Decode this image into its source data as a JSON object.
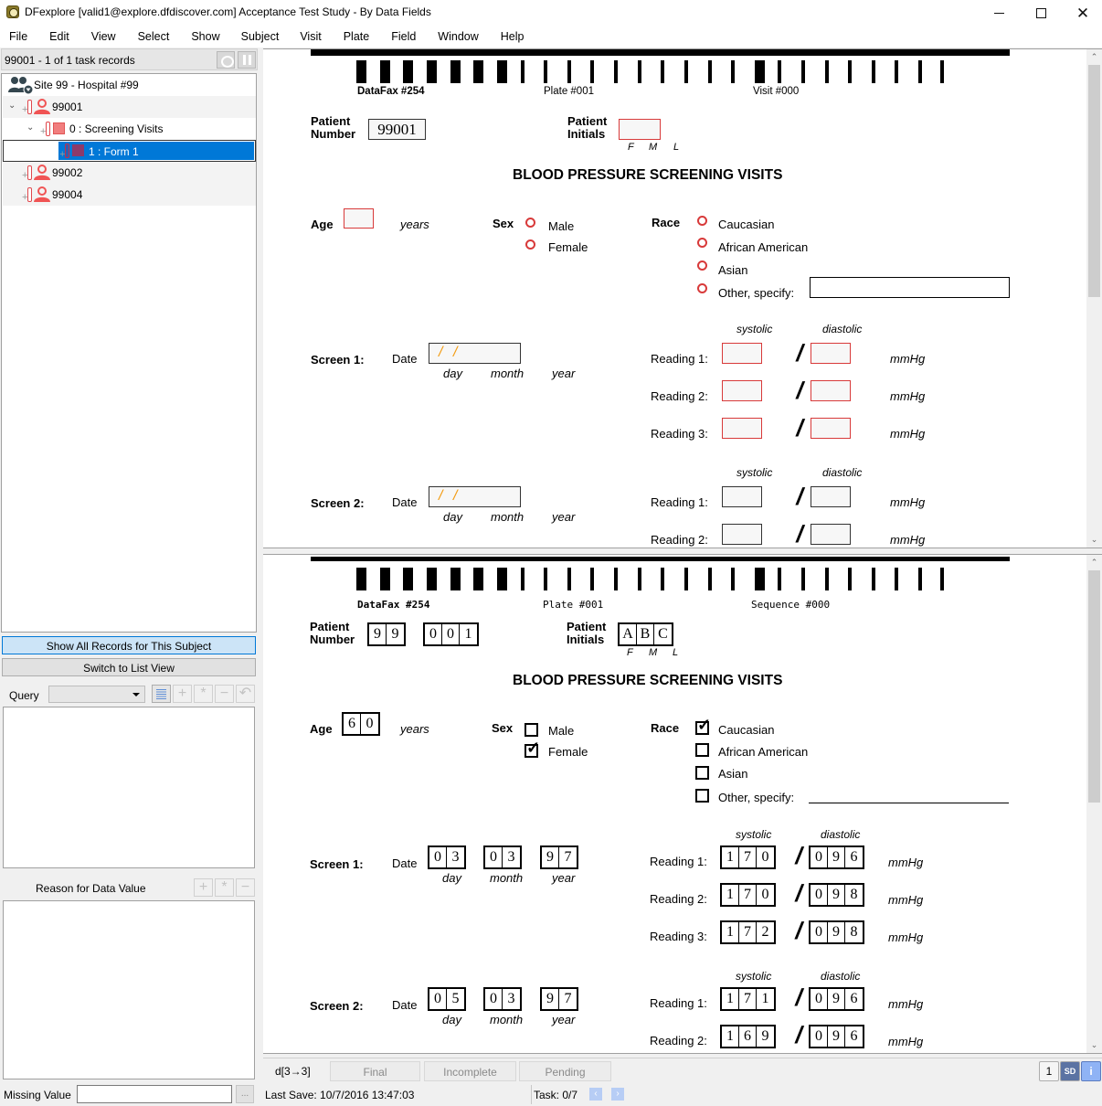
{
  "window": {
    "title": "DFexplore [valid1@explore.dfdiscover.com] Acceptance Test Study - By Data Fields",
    "minimize_icon": "minimize-icon",
    "maximize_icon": "maximize-icon",
    "close_icon": "close-icon"
  },
  "menu": [
    "File",
    "Edit",
    "View",
    "Select",
    "Show",
    "Subject",
    "Visit",
    "Plate",
    "Field",
    "Window",
    "Help"
  ],
  "left_panel": {
    "task_header": "99001 - 1 of 1 task records",
    "tree": {
      "site": "Site 99 - Hospital #99",
      "subjects": [
        {
          "id": "99001",
          "expanded": true
        },
        {
          "id": "99002",
          "expanded": false
        },
        {
          "id": "99004",
          "expanded": false
        }
      ],
      "visit": "0 : Screening Visits",
      "form": "1 : Form 1"
    },
    "show_all_button": "Show All Records for This Subject",
    "list_view_button": "Switch to List View",
    "query_label": "Query",
    "query_value": "",
    "reason_label": "Reason for Data Value",
    "missing_value_label": "Missing Value",
    "missing_value": "",
    "missing_value_button": "..."
  },
  "form_top": {
    "header_left": "DataFax #254",
    "header_mid": "Plate #001",
    "header_right": "Visit #000",
    "patient_number_label_1": "Patient",
    "patient_number_label_2": "Number",
    "patient_number": "99001",
    "patient_initials_label_1": "Patient",
    "patient_initials_label_2": "Initials",
    "initials_f": "F",
    "initials_m": "M",
    "initials_l": "L",
    "title": "BLOOD PRESSURE SCREENING VISITS",
    "age_label": "Age",
    "age_value": "",
    "years": "years",
    "sex_label": "Sex",
    "sex_options": [
      "Male",
      "Female"
    ],
    "race_label": "Race",
    "race_options": [
      "Caucasian",
      "African American",
      "Asian",
      "Other, specify:"
    ],
    "screen1_label": "Screen 1:",
    "screen2_label": "Screen 2:",
    "date_label": "Date",
    "day": "day",
    "month": "month",
    "year": "year",
    "systolic": "systolic",
    "diastolic": "diastolic",
    "reading1": "Reading 1:",
    "reading2": "Reading 2:",
    "reading3": "Reading 3:",
    "mmhg": "mmHg"
  },
  "form_scan": {
    "header_left": "DataFax #254",
    "header_mid": "Plate #001",
    "header_right": "Sequence #000",
    "patient_number_digits_a": [
      "9",
      "9"
    ],
    "patient_number_digits_b": [
      "0",
      "0",
      "1"
    ],
    "initials": [
      "A",
      "B",
      "C"
    ],
    "age_digits": [
      "6",
      "0"
    ],
    "sex_checked": "Female",
    "race_checked": "Caucasian",
    "screen1": {
      "date": {
        "day": [
          "0",
          "3"
        ],
        "month": [
          "0",
          "3"
        ],
        "year": [
          "9",
          "7"
        ]
      },
      "readings": [
        {
          "sys": [
            "1",
            "7",
            "0"
          ],
          "dia": [
            "0",
            "9",
            "6"
          ]
        },
        {
          "sys": [
            "1",
            "7",
            "0"
          ],
          "dia": [
            "0",
            "9",
            "8"
          ]
        },
        {
          "sys": [
            "1",
            "7",
            "2"
          ],
          "dia": [
            "0",
            "9",
            "8"
          ]
        }
      ]
    },
    "screen2": {
      "date": {
        "day": [
          "0",
          "5"
        ],
        "month": [
          "0",
          "3"
        ],
        "year": [
          "9",
          "7"
        ]
      },
      "readings": [
        {
          "sys": [
            "1",
            "7",
            "1"
          ],
          "dia": [
            "0",
            "9",
            "6"
          ]
        },
        {
          "sys": [
            "1",
            "6",
            "9"
          ],
          "dia": [
            "0",
            "9",
            "6"
          ]
        }
      ]
    }
  },
  "status": {
    "level": "d[3→3]",
    "final": "Final",
    "incomplete": "Incomplete",
    "pending": "Pending",
    "page": "1",
    "sd": "SD",
    "info": "i",
    "last_save": "Last Save: 10/7/2016 13:47:03",
    "task": "Task: 0/7"
  }
}
